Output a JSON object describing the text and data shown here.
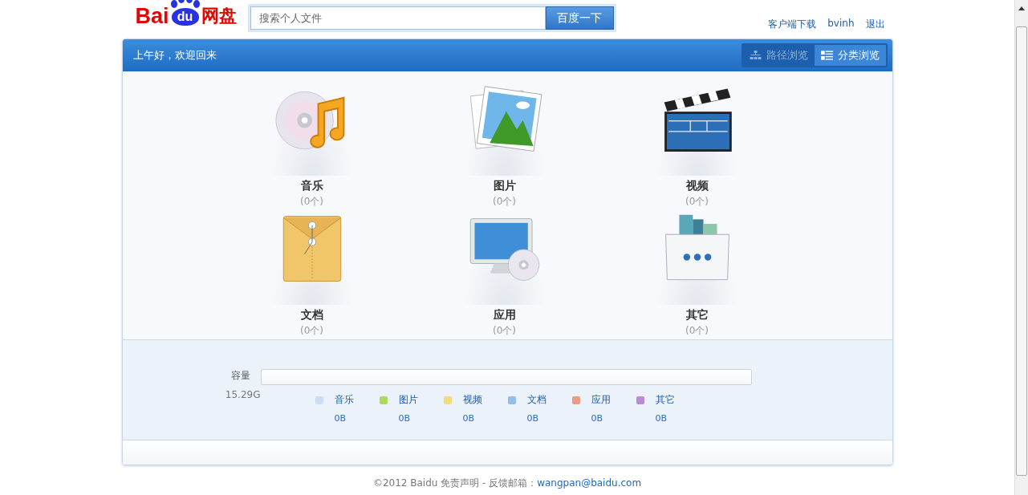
{
  "logo": {
    "part_1": "Bai",
    "part_2": "du",
    "part_3": "网盘"
  },
  "search": {
    "placeholder": "搜索个人文件",
    "button": "百度一下"
  },
  "user_links": [
    {
      "label": "客户端下载"
    },
    {
      "label": "bvinh"
    },
    {
      "label": "退出"
    }
  ],
  "banner": {
    "greeting": "上午好，欢迎回来",
    "views": [
      {
        "label": "路径浏览",
        "kind": "path",
        "selected": false
      },
      {
        "label": "分类浏览",
        "kind": "category",
        "selected": true
      }
    ]
  },
  "categories": [
    {
      "kind": "music",
      "label": "音乐",
      "count": "(0个)"
    },
    {
      "kind": "picture",
      "label": "图片",
      "count": "(0个)"
    },
    {
      "kind": "video",
      "label": "视频",
      "count": "(0个)"
    },
    {
      "kind": "document",
      "label": "文档",
      "count": "(0个)"
    },
    {
      "kind": "app",
      "label": "应用",
      "count": "(0个)"
    },
    {
      "kind": "other",
      "label": "其它",
      "count": "(0个)"
    }
  ],
  "capacity": {
    "label": "容量",
    "total": "15.29G",
    "level": 0,
    "legend": [
      {
        "label": "音乐",
        "size": "0B",
        "color": "#cfdcf5"
      },
      {
        "label": "图片",
        "size": "0B",
        "color": "#a8dc5a"
      },
      {
        "label": "视频",
        "size": "0B",
        "color": "#f2dc7c"
      },
      {
        "label": "文档",
        "size": "0B",
        "color": "#92bdec"
      },
      {
        "label": "应用",
        "size": "0B",
        "color": "#e89e80"
      },
      {
        "label": "其它",
        "size": "0B",
        "color": "#bc8ad8"
      }
    ]
  },
  "footer": {
    "text": "©2012 Baidu 免责声明 - 反馈邮箱：",
    "email": "wangpan@baidu.com"
  }
}
